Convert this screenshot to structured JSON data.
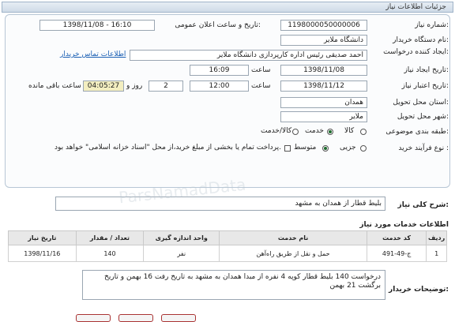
{
  "header": {
    "title": "جزئیات اطلاعات نیاز"
  },
  "form": {
    "need_number_label": "شماره نیاز:",
    "need_number": "1198000050000006",
    "announce_label": "تاریخ و ساعت اعلان عمومی:",
    "announce_value": "1398/11/08 - 16:10",
    "buyer_org_label": "نام دستگاه خریدار:",
    "buyer_org": "دانشگاه ملایر",
    "creator_label": "ایجاد کننده درخواست:",
    "creator": "احمد صدیقی رئیس اداره کارپردازی دانشگاه ملایر",
    "contact_link": "اطلاعات تماس خریدار",
    "create_date_label": "تاریخ ایجاد نیاز:",
    "create_date": "1398/11/08",
    "time_label": "ساعت",
    "create_time": "16:09",
    "deadline_label": "تاریخ اعتبار نیاز:",
    "deadline_date": "1398/11/12",
    "deadline_time": "12:00",
    "days_label": "روز و",
    "days_value": "2",
    "remaining_value": "04:05:27",
    "remaining_label": "ساعت باقی مانده",
    "province_label": "استان محل تحویل:",
    "province": "همدان",
    "city_label": "شهر محل تحویل:",
    "city": "ملایر",
    "category_label": "طبقه بندی موضوعی:",
    "category_options": [
      "کالا",
      "خدمت",
      "کالا/خدمت"
    ],
    "category_selected": "خدمت",
    "process_label": "نوع فرآیند خرید :",
    "process_options": [
      "جزیی",
      "متوسط"
    ],
    "process_selected": "متوسط",
    "treasury_note": "پرداخت تمام یا بخشی از مبلغ خرید،از محل \"اسناد خزانه اسلامی\" خواهد بود."
  },
  "summary": {
    "label": "شرح کلی نیاز:",
    "value": "بلیط قطار از همدان به مشهد"
  },
  "services": {
    "title": "اطلاعات خدمات مورد نیاز",
    "columns": [
      "ردیف",
      "کد خدمت",
      "نام خدمت",
      "واحد اندازه گیری",
      "تعداد / مقدار",
      "تاریخ نیاز"
    ],
    "rows": [
      [
        "1",
        "ج-49-491",
        "حمل و نقل از طریق راه‌آهن",
        "نفر",
        "140",
        "1398/11/16"
      ]
    ]
  },
  "buyer_notes": {
    "label": "توضیحات خریدار:",
    "value": "درخواست 140 بلیط قطار کوپه 4 نفره از مبدا همدان به مشهد به تاریخ رفت 16 بهمن و تاریخ برگشت 21 بهمن"
  }
}
